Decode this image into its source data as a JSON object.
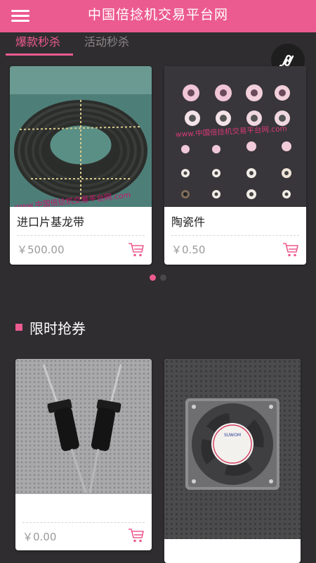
{
  "header": {
    "title": "中国倍捻机交易平台网",
    "menu_icon": "hamburger-menu-icon"
  },
  "tabs": [
    {
      "label": "爆款秒杀",
      "active": true
    },
    {
      "label": "活动秒杀",
      "active": false
    }
  ],
  "share_icon": "share-link-icon",
  "flash_sale": {
    "products": [
      {
        "name": "进口片基龙带",
        "price": "￥500.00",
        "image": "belt-reel-photo",
        "watermark": "www.中国倍捻机交易平台网.com"
      },
      {
        "name": "陶瓷件",
        "price": "￥0.50",
        "image": "ceramic-parts-photo",
        "watermark": "www.中国倍捻机交易平台网.com"
      }
    ]
  },
  "carousel": {
    "pages": 2,
    "active_index": 0
  },
  "coupon_section": {
    "title": "限时抢券",
    "products": [
      {
        "name": "",
        "price": "￥0.00",
        "image": "spindle-parts-photo"
      },
      {
        "name": "",
        "price": "",
        "image": "cooling-fan-photo",
        "fan_brand": "SUWOM"
      }
    ]
  },
  "colors": {
    "accent": "#ec5b8f",
    "background": "#2f2d2f",
    "inactive_tab": "#8b8788",
    "dot_inactive": "#4a4748"
  }
}
